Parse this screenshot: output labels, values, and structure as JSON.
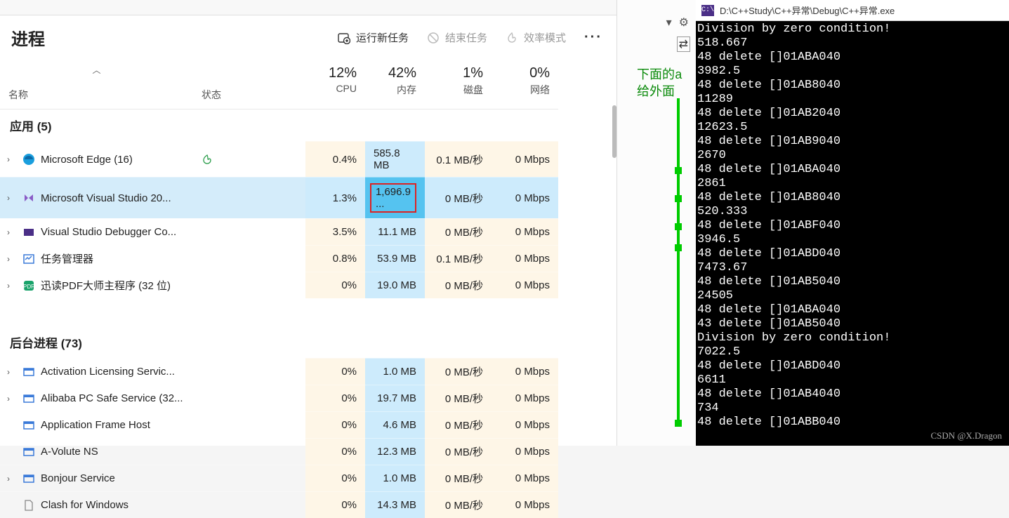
{
  "taskmgr": {
    "title": "进程",
    "actions": {
      "new_task": "运行新任务",
      "end_task": "结束任务",
      "efficiency": "效率模式"
    },
    "headers": {
      "name": "名称",
      "status": "状态",
      "cpu_pct": "12%",
      "cpu_lbl": "CPU",
      "mem_pct": "42%",
      "mem_lbl": "内存",
      "disk_pct": "1%",
      "disk_lbl": "磁盘",
      "net_pct": "0%",
      "net_lbl": "网络"
    },
    "groups": {
      "apps": "应用 (5)",
      "bg": "后台进程 (73)"
    },
    "rows": [
      {
        "icon": "edge",
        "name": "Microsoft Edge (16)",
        "status_icon": "leaf",
        "cpu": "0.4%",
        "mem": "585.8 MB",
        "disk": "0.1 MB/秒",
        "net": "0 Mbps",
        "exp": true
      },
      {
        "icon": "vs",
        "name": "Microsoft Visual Studio 20...",
        "cpu": "1.3%",
        "mem": "1,696.9 ...",
        "disk": "0 MB/秒",
        "net": "0 Mbps",
        "exp": true,
        "sel": true,
        "redbox": true
      },
      {
        "icon": "vsd",
        "name": "Visual Studio Debugger Co...",
        "cpu": "3.5%",
        "mem": "11.1 MB",
        "disk": "0 MB/秒",
        "net": "0 Mbps",
        "exp": true
      },
      {
        "icon": "tm",
        "name": "任务管理器",
        "cpu": "0.8%",
        "mem": "53.9 MB",
        "disk": "0.1 MB/秒",
        "net": "0 Mbps",
        "exp": true
      },
      {
        "icon": "pdf",
        "name": "迅读PDF大师主程序 (32 位)",
        "cpu": "0%",
        "mem": "19.0 MB",
        "disk": "0 MB/秒",
        "net": "0 Mbps",
        "exp": true
      }
    ],
    "bg_rows": [
      {
        "icon": "gen",
        "name": "Activation Licensing Servic...",
        "cpu": "0%",
        "mem": "1.0 MB",
        "disk": "0 MB/秒",
        "net": "0 Mbps",
        "exp": true
      },
      {
        "icon": "gen",
        "name": "Alibaba PC Safe Service (32...",
        "cpu": "0%",
        "mem": "19.7 MB",
        "disk": "0 MB/秒",
        "net": "0 Mbps",
        "exp": true
      },
      {
        "icon": "gen",
        "name": "Application Frame Host",
        "cpu": "0%",
        "mem": "4.6 MB",
        "disk": "0 MB/秒",
        "net": "0 Mbps"
      },
      {
        "icon": "gen",
        "name": "A-Volute NS",
        "cpu": "0%",
        "mem": "12.3 MB",
        "disk": "0 MB/秒",
        "net": "0 Mbps"
      },
      {
        "icon": "gen",
        "name": "Bonjour Service",
        "cpu": "0%",
        "mem": "1.0 MB",
        "disk": "0 MB/秒",
        "net": "0 Mbps",
        "exp": true
      },
      {
        "icon": "file",
        "name": "Clash for Windows",
        "cpu": "0%",
        "mem": "14.3 MB",
        "disk": "0 MB/秒",
        "net": "0 Mbps"
      }
    ]
  },
  "editor": {
    "snip1": "下面的a",
    "snip2": "给外面"
  },
  "console": {
    "icon_text": "C:\\",
    "title": "D:\\C++Study\\C++异常\\Debug\\C++异常.exe",
    "lines": [
      "Division by zero condition!",
      "518.667",
      "48 delete []01ABA040",
      "3982.5",
      "48 delete []01AB8040",
      "11289",
      "48 delete []01AB2040",
      "12623.5",
      "48 delete []01AB9040",
      "2670",
      "48 delete []01ABA040",
      "2861",
      "48 delete []01AB8040",
      "520.333",
      "48 delete []01ABF040",
      "3946.5",
      "48 delete []01ABD040",
      "7473.67",
      "48 delete []01AB5040",
      "24505",
      "48 delete []01ABA040",
      "43 delete []01AB5040",
      "Division by zero condition!",
      "7022.5",
      "48 delete []01ABD040",
      "6611",
      "48 delete []01AB4040",
      "734",
      "48 delete []01ABB040"
    ]
  },
  "watermark": "CSDN @X.Dragon"
}
